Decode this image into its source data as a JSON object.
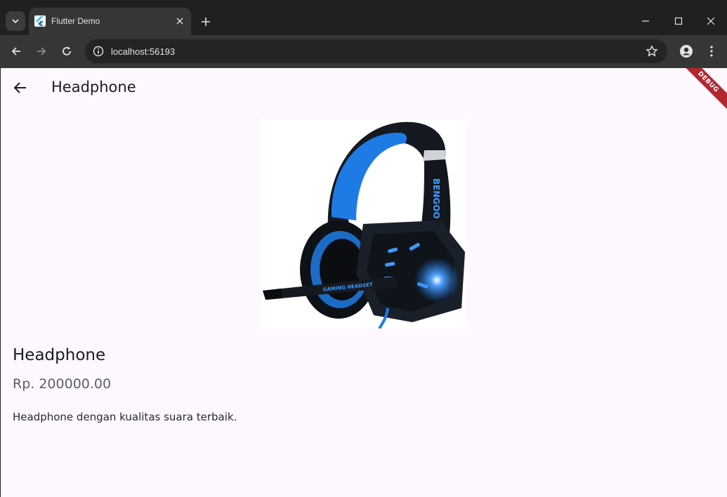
{
  "browser": {
    "tab_title": "Flutter Demo",
    "url": "localhost:56193"
  },
  "app": {
    "appbar_title": "Headphone",
    "debug_banner": "DEBUG",
    "product": {
      "name": "Headphone",
      "price": "Rp. 200000.00",
      "description": "Headphone dengan kualitas suara terbaik.",
      "image_icon": "headphone-image",
      "image_text": "BENGOO",
      "image_subtext": "GAMING HEADSET"
    },
    "colors": {
      "accent_blue": "#1e7be6",
      "background": "#fdf7fe",
      "debug_red": "#b3262f"
    }
  }
}
